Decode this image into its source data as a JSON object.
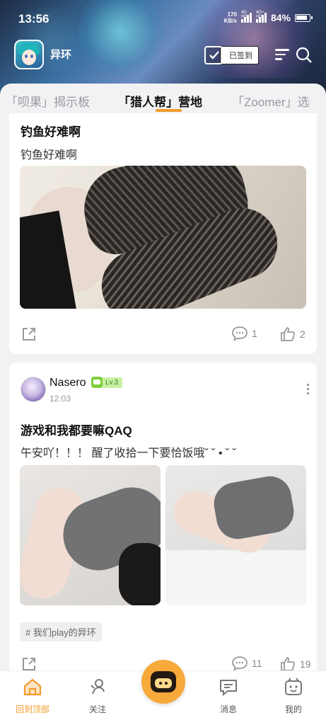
{
  "status_bar": {
    "time": "13:56",
    "speed_value": "170",
    "speed_unit": "KB/s",
    "sim1": "4G HD",
    "sim2": "4G+ HD",
    "battery": "84%"
  },
  "app_bar": {
    "app_name": "异环",
    "checkin_label": "已签到"
  },
  "tabs": [
    {
      "label": "「呗果」揭示板",
      "active": false
    },
    {
      "label": "「猎人帮」营地",
      "active": true
    },
    {
      "label": "「Zoomer」选",
      "active": false
    }
  ],
  "accent_color": "#f39a2b",
  "posts": [
    {
      "title": "钓鱼好难啊",
      "body": "钓鱼好难啊",
      "comments": "1",
      "likes": "2"
    },
    {
      "author": "Nasero",
      "level": "Lv.3",
      "time": "12:03",
      "title": "游戏和我都要嘛QAQ",
      "body": "午安吖！！！ 醒了收拾一下要恰饭哦˘ ˘ • ˘ ˘",
      "tag": "# 我们play的异环",
      "comments": "11",
      "likes": "19"
    }
  ],
  "bottom_nav": [
    {
      "label": "回到顶部",
      "icon": "home-icon",
      "active": true
    },
    {
      "label": "关注",
      "icon": "follow-icon",
      "active": false
    },
    {
      "label": "",
      "icon": "mascot-icon",
      "active": false
    },
    {
      "label": "消息",
      "icon": "message-icon",
      "active": false
    },
    {
      "label": "我的",
      "icon": "profile-icon",
      "active": false
    }
  ]
}
